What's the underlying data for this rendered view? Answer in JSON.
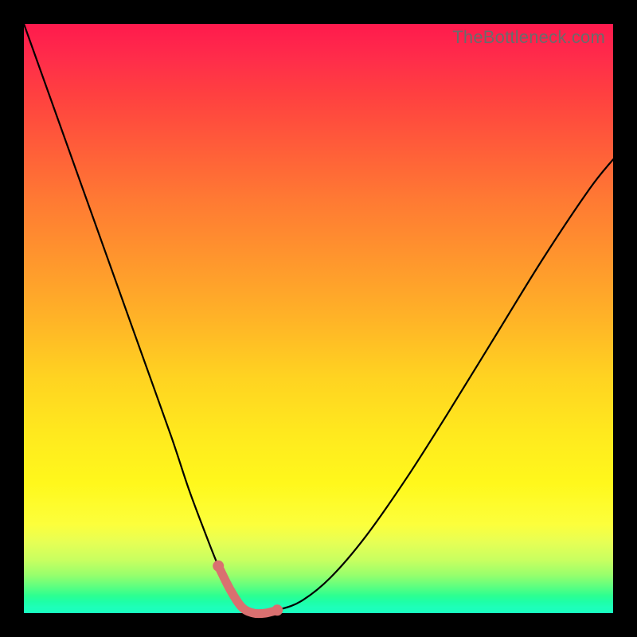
{
  "watermark": "TheBottleneck.com",
  "chart_data": {
    "type": "line",
    "title": "",
    "xlabel": "",
    "ylabel": "",
    "xlim": [
      0,
      100
    ],
    "ylim": [
      0,
      100
    ],
    "grid": false,
    "series": [
      {
        "name": "bottleneck-curve",
        "x": [
          0,
          5,
          10,
          15,
          20,
          25,
          28,
          31,
          33,
          35,
          37,
          39,
          41,
          43,
          47,
          52,
          58,
          65,
          72,
          80,
          88,
          96,
          100
        ],
        "values": [
          100,
          86,
          72,
          58,
          44,
          30,
          21,
          13,
          8,
          4,
          1,
          0,
          0,
          0.5,
          2,
          6,
          13,
          23,
          34,
          47,
          60,
          72,
          77
        ]
      }
    ],
    "highlight": {
      "name": "optimal-range",
      "x": [
        33,
        35,
        37,
        39,
        41,
        43
      ],
      "values": [
        8,
        4,
        1,
        0,
        0,
        0.5
      ],
      "color": "#d97070"
    },
    "background_gradient": {
      "top": "#ff1a4d",
      "upper_mid": "#ffb327",
      "lower_mid": "#fff81c",
      "bottom": "#18ffc0"
    }
  }
}
